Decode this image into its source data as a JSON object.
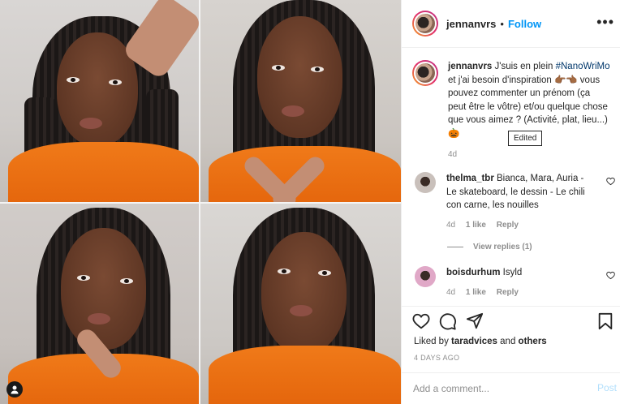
{
  "post": {
    "username": "jennanvrs",
    "follow_label": "Follow",
    "separator": "•",
    "more_label": "•••"
  },
  "caption": {
    "username": "jennanvrs",
    "text_before": "J'suis en plein",
    "hashtag": "#NanoWriMo",
    "text_after": "et j'ai besoin d'inspiration 👉🏾👈🏾 vous pouvez commenter un prénom (ça peut être le vôtre) et/ou quelque chose que vous aimez ? (Activité, plat, lieu...) 🎃",
    "time": "4d",
    "tooltip": "Edited"
  },
  "comments": [
    {
      "username": "thelma_tbr",
      "text": "Bianca, Mara, Auria - Le skateboard, le dessin - Le chili con carne, les nouilles",
      "time": "4d",
      "likes": "1 like",
      "reply": "Reply",
      "view_replies": "View replies (1)"
    },
    {
      "username": "boisdurhum",
      "text": "Isyld",
      "time": "4d",
      "likes": "1 like",
      "reply": "Reply"
    }
  ],
  "actions": {
    "liked_by_prefix": "Liked by",
    "liked_by_user": "taradvices",
    "liked_by_and": "and",
    "liked_by_others": "others",
    "date": "4 DAYS AGO"
  },
  "add_comment": {
    "placeholder": "Add a comment...",
    "post_label": "Post"
  },
  "icons": [
    "heart-icon",
    "comment-icon",
    "share-icon",
    "bookmark-icon",
    "more-options-icon",
    "user-tag-icon"
  ],
  "colors": {
    "accent": "#0095f6",
    "text": "#262626",
    "muted": "#8e8e8e",
    "hoodie": "#f07a19"
  }
}
